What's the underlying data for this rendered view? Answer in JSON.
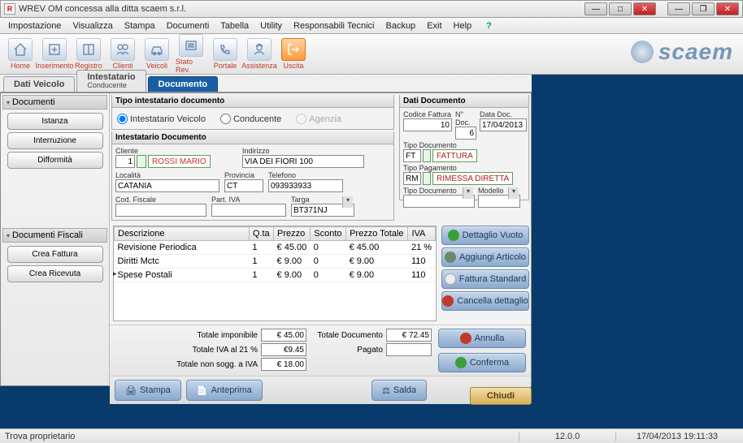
{
  "window": {
    "title": "WREV OM concessa alla ditta scaem s.r.l."
  },
  "menu": [
    "Impostazione",
    "Visualizza",
    "Stampa",
    "Documenti",
    "Tabella",
    "Utility",
    "Responsabili Tecnici",
    "Backup",
    "Exit",
    "Help"
  ],
  "toolbar": [
    {
      "label": "Home",
      "icon": "home-icon"
    },
    {
      "label": "Inserimento",
      "icon": "insert-icon"
    },
    {
      "label": "Registro",
      "icon": "book-icon"
    },
    {
      "label": "Clienti",
      "icon": "people-icon"
    },
    {
      "label": "Veicoli",
      "icon": "car-icon"
    },
    {
      "label": "Stato Rev.",
      "icon": "status-icon"
    },
    {
      "label": "Portale",
      "icon": "phone-icon"
    },
    {
      "label": "Assistenza",
      "icon": "support-icon"
    },
    {
      "label": "Uscita",
      "icon": "exit-icon"
    }
  ],
  "brand": "scaem",
  "tabs": [
    {
      "label": "Dati Veicolo"
    },
    {
      "label": "Intestatario",
      "sub": "Conducente"
    },
    {
      "label": "Documento"
    }
  ],
  "sidebar": {
    "group1": "Documenti",
    "buttons1": [
      "Istanza",
      "Interruzione",
      "Difformità"
    ],
    "group2": "Documenti Fiscali",
    "buttons2": [
      "Crea Fattura",
      "Crea Ricevuta"
    ]
  },
  "tipo_intestatario": {
    "title": "Tipo intestatario documento",
    "opts": [
      "Intestatario Veicolo",
      "Conducente",
      "Agenzia"
    ]
  },
  "intestatario": {
    "title": "Intestatario Documento",
    "cliente_lbl": "Cliente",
    "cliente_num": "1",
    "cliente_name": "ROSSI MARIO",
    "indirizzo_lbl": "Indirizzo",
    "indirizzo": "VIA DEI FIORI 100",
    "localita_lbl": "Località",
    "localita": "CATANIA",
    "provincia_lbl": "Provincia",
    "provincia": "CT",
    "telefono_lbl": "Telefono",
    "telefono": "093933933",
    "codfisc_lbl": "Cod. Fiscale",
    "codfisc": "",
    "piva_lbl": "Part. IVA",
    "piva": "",
    "targa_lbl": "Targa",
    "targa": "BT371NJ"
  },
  "dati_doc": {
    "title": "Dati Documento",
    "codfatt_lbl": "Codice Fattura",
    "codfatt": "10",
    "ndoc_lbl": "N° Doc.",
    "ndoc": "6",
    "datadoc_lbl": "Data Doc.",
    "datadoc": "17/04/2013",
    "tipodoc_lbl": "Tipo Documento",
    "tipodoc_code": "FT",
    "tipodoc_txt": "FATTURA",
    "tipopag_lbl": "Tipo Pagamento",
    "tipopag_code": "RM",
    "tipopag_txt": "RIMESSA DIRETTA",
    "tipodoc2_lbl": "Tipo Documento",
    "modello_lbl": "Modello"
  },
  "table": {
    "headers": [
      "Descrizione",
      "Q.ta",
      "Prezzo",
      "Sconto",
      "Prezzo Totale",
      "IVA"
    ],
    "rows": [
      {
        "d": "Revisione Periodica",
        "q": "1",
        "p": "€ 45.00",
        "s": "0",
        "pt": "€ 45.00",
        "iva": "21 %"
      },
      {
        "d": "Diritti Mctc",
        "q": "1",
        "p": "€ 9.00",
        "s": "0",
        "pt": "€ 9.00",
        "iva": "110"
      },
      {
        "d": "Spese Postali",
        "q": "1",
        "p": "€ 9.00",
        "s": "0",
        "pt": "€ 9.00",
        "iva": "110"
      }
    ]
  },
  "actions": {
    "dettaglio": "Dettaglio Vuoto",
    "aggiungi": "Aggiungi Articolo",
    "standard": "Fattura Standard",
    "cancella_det": "Cancella dettaglio",
    "annulla": "Annulla",
    "conferma": "Conferma",
    "stampa": "Stampa",
    "anteprima": "Anteprima",
    "salda": "Salda",
    "chiudi": "Chiudi"
  },
  "totals": {
    "imponibile_lbl": "Totale imponibile",
    "imponibile": "€ 45.00",
    "iva21_lbl": "Totale IVA al 21 %",
    "iva21": "€9.45",
    "nonsogg_lbl": "Totale non sogg. a IVA",
    "nonsogg": "€ 18.00",
    "totdoc_lbl": "Totale Documento",
    "totdoc": "€ 72.45",
    "pagato_lbl": "Pagato",
    "pagato": ""
  },
  "status": {
    "left": "Trova proprietario",
    "ver": "12.0.0",
    "dt": "17/04/2013 19:11:33"
  }
}
